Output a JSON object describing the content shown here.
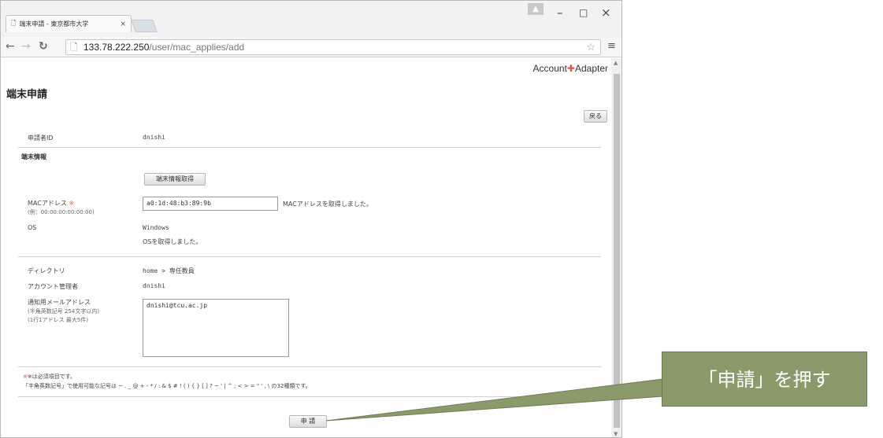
{
  "browser": {
    "tab_title": "端末申請 - 東京都市大学",
    "tab_close": "×",
    "url_host": "133.78.222.250",
    "url_path": "/user/mac_applies/add",
    "window_controls": [
      "–",
      "□",
      "×"
    ]
  },
  "page": {
    "logo_text_1": "Account",
    "logo_text_2": "Adapter",
    "title": "端末申請",
    "back_button": "戻る",
    "applicant_label": "申請者ID",
    "applicant_value": "dnishi",
    "device_section": "端末情報",
    "get_info_button": "端末情報取得",
    "mac_label": "MACアドレス",
    "mac_required": "※",
    "mac_example": "(例：00:00:00:00:00:00)",
    "mac_value": "a0:1d:48:b3:89:9b",
    "mac_status": "MACアドレスを取得しました。",
    "os_label": "OS",
    "os_value": "Windows",
    "os_status": "OSを取得しました。",
    "directory_label": "ディレクトリ",
    "directory_value": "home > 専任教員",
    "account_manager_label": "アカウント管理者",
    "account_manager_value": "dnishi",
    "email_label": "通知用メールアドレス",
    "email_note_1": "(半角英数記号 254文字以内)",
    "email_note_2": "(1行1アドレス 最大5件)",
    "email_value": "dnishi@tcu.ac.jp",
    "required_note": "※は必須項目です。",
    "symbols_note": "「半角英数記号」で使用可能な記号は ~ . _ @ + - * / : & $ # ! ( ) { } [ ] ? ~ ' | ^ ; < > = \" ' , \\ の32種類です。",
    "submit_button": "申 請"
  },
  "annotation": {
    "callout_text": "「申請」を押す"
  },
  "colors": {
    "callout_bg": "#8b9a6b",
    "required": "#e05a5a"
  }
}
